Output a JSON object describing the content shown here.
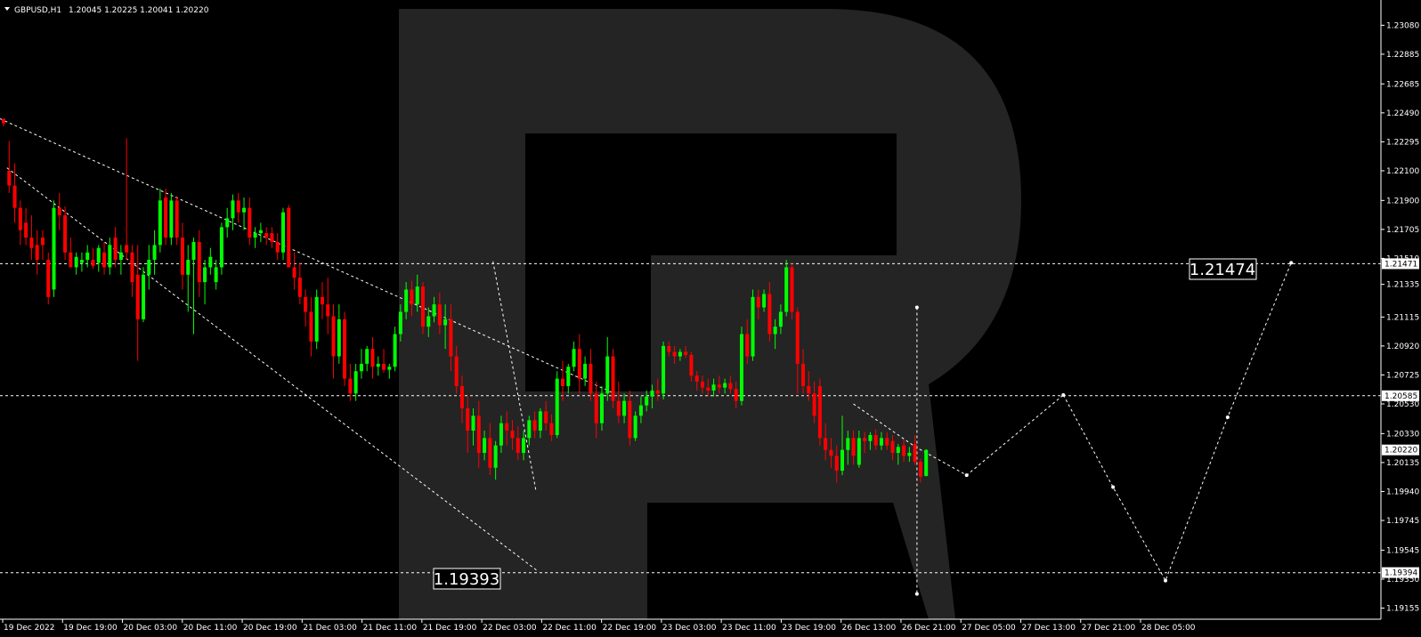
{
  "header": {
    "symbol": "GBPUSD,H1",
    "ohlc": "1.20045 1.20225 1.20041 1.20220"
  },
  "colors": {
    "background": "#000000",
    "bull": "#00ff00",
    "bear": "#ff0000",
    "grid_line": "#ffffff",
    "watermark": "#242424",
    "text": "#ffffff"
  },
  "annotations": {
    "target_high": "1.21474",
    "target_low": "1.19393"
  },
  "chart_data": {
    "type": "candlestick",
    "symbol": "GBPUSD",
    "timeframe": "H1",
    "ylim": [
      1.1908,
      1.2325
    ],
    "y_ticks": [
      "1.23080",
      "1.22885",
      "1.22685",
      "1.22490",
      "1.22295",
      "1.22100",
      "1.21900",
      "1.21705",
      "1.21510",
      "1.21335",
      "1.21115",
      "1.20920",
      "1.20725",
      "1.20530",
      "1.20330",
      "1.20135",
      "1.19940",
      "1.19745",
      "1.19545",
      "1.19350",
      "1.19155"
    ],
    "x_ticks": [
      "19 Dec 2022",
      "19 Dec 19:00",
      "20 Dec 03:00",
      "20 Dec 11:00",
      "20 Dec 19:00",
      "21 Dec 03:00",
      "21 Dec 11:00",
      "21 Dec 19:00",
      "22 Dec 03:00",
      "22 Dec 11:00",
      "22 Dec 19:00",
      "23 Dec 03:00",
      "23 Dec 11:00",
      "23 Dec 19:00",
      "26 Dec 13:00",
      "26 Dec 21:00",
      "27 Dec 05:00",
      "27 Dec 13:00",
      "27 Dec 21:00",
      "28 Dec 05:00"
    ],
    "price_markers": [
      {
        "value": 1.21474,
        "label": "1.21471"
      },
      {
        "value": 1.20585,
        "label": "1.20585"
      },
      {
        "value": 1.2022,
        "label": "1.20220"
      },
      {
        "value": 1.19394,
        "label": "1.19394"
      }
    ],
    "horizontal_levels": [
      1.21474,
      1.20585,
      1.19393
    ],
    "candles": [
      {
        "o": 1.2245,
        "h": 1.2245,
        "l": 1.224,
        "c": 1.2242
      },
      {
        "o": 1.221,
        "h": 1.223,
        "l": 1.2195,
        "c": 1.22
      },
      {
        "o": 1.22,
        "h": 1.2215,
        "l": 1.2175,
        "c": 1.2185
      },
      {
        "o": 1.2185,
        "h": 1.219,
        "l": 1.216,
        "c": 1.217
      },
      {
        "o": 1.2175,
        "h": 1.2185,
        "l": 1.216,
        "c": 1.2165
      },
      {
        "o": 1.2165,
        "h": 1.218,
        "l": 1.215,
        "c": 1.2158
      },
      {
        "o": 1.216,
        "h": 1.217,
        "l": 1.214,
        "c": 1.215
      },
      {
        "o": 1.2165,
        "h": 1.217,
        "l": 1.215,
        "c": 1.216
      },
      {
        "o": 1.215,
        "h": 1.2155,
        "l": 1.212,
        "c": 1.2125
      },
      {
        "o": 1.213,
        "h": 1.219,
        "l": 1.2125,
        "c": 1.2185
      },
      {
        "o": 1.2185,
        "h": 1.2195,
        "l": 1.217,
        "c": 1.218
      },
      {
        "o": 1.218,
        "h": 1.2186,
        "l": 1.215,
        "c": 1.2155
      },
      {
        "o": 1.2155,
        "h": 1.2165,
        "l": 1.2145,
        "c": 1.2145
      },
      {
        "o": 1.2145,
        "h": 1.2155,
        "l": 1.214,
        "c": 1.2152
      },
      {
        "o": 1.2148,
        "h": 1.2155,
        "l": 1.2142,
        "c": 1.215
      },
      {
        "o": 1.215,
        "h": 1.216,
        "l": 1.2145,
        "c": 1.2155
      },
      {
        "o": 1.215,
        "h": 1.2158,
        "l": 1.2144,
        "c": 1.2146
      },
      {
        "o": 1.2148,
        "h": 1.216,
        "l": 1.2142,
        "c": 1.2158
      },
      {
        "o": 1.2155,
        "h": 1.2162,
        "l": 1.214,
        "c": 1.2145
      },
      {
        "o": 1.2145,
        "h": 1.2165,
        "l": 1.214,
        "c": 1.216
      },
      {
        "o": 1.2165,
        "h": 1.2172,
        "l": 1.2145,
        "c": 1.215
      },
      {
        "o": 1.215,
        "h": 1.216,
        "l": 1.214,
        "c": 1.2155
      },
      {
        "o": 1.216,
        "h": 1.2232,
        "l": 1.215,
        "c": 1.2155
      },
      {
        "o": 1.2155,
        "h": 1.216,
        "l": 1.2125,
        "c": 1.2135
      },
      {
        "o": 1.214,
        "h": 1.216,
        "l": 1.2082,
        "c": 1.211
      },
      {
        "o": 1.211,
        "h": 1.2145,
        "l": 1.2108,
        "c": 1.214
      },
      {
        "o": 1.214,
        "h": 1.216,
        "l": 1.213,
        "c": 1.215
      },
      {
        "o": 1.215,
        "h": 1.217,
        "l": 1.214,
        "c": 1.216
      },
      {
        "o": 1.216,
        "h": 1.2198,
        "l": 1.2155,
        "c": 1.219
      },
      {
        "o": 1.2192,
        "h": 1.2198,
        "l": 1.216,
        "c": 1.2165
      },
      {
        "o": 1.2165,
        "h": 1.2195,
        "l": 1.216,
        "c": 1.219
      },
      {
        "o": 1.219,
        "h": 1.2193,
        "l": 1.216,
        "c": 1.2165
      },
      {
        "o": 1.2165,
        "h": 1.2175,
        "l": 1.213,
        "c": 1.214
      },
      {
        "o": 1.214,
        "h": 1.216,
        "l": 1.2115,
        "c": 1.215
      },
      {
        "o": 1.215,
        "h": 1.2165,
        "l": 1.21,
        "c": 1.2162
      },
      {
        "o": 1.2162,
        "h": 1.217,
        "l": 1.2125,
        "c": 1.2135
      },
      {
        "o": 1.2135,
        "h": 1.215,
        "l": 1.212,
        "c": 1.2145
      },
      {
        "o": 1.2145,
        "h": 1.2158,
        "l": 1.214,
        "c": 1.2152
      },
      {
        "o": 1.2135,
        "h": 1.215,
        "l": 1.213,
        "c": 1.2145
      },
      {
        "o": 1.2145,
        "h": 1.2175,
        "l": 1.214,
        "c": 1.2172
      },
      {
        "o": 1.2172,
        "h": 1.2185,
        "l": 1.2165,
        "c": 1.2178
      },
      {
        "o": 1.2178,
        "h": 1.2194,
        "l": 1.217,
        "c": 1.219
      },
      {
        "o": 1.219,
        "h": 1.2195,
        "l": 1.2175,
        "c": 1.2182
      },
      {
        "o": 1.2182,
        "h": 1.2192,
        "l": 1.217,
        "c": 1.2185
      },
      {
        "o": 1.2185,
        "h": 1.2192,
        "l": 1.216,
        "c": 1.2165
      },
      {
        "o": 1.2165,
        "h": 1.2172,
        "l": 1.2158,
        "c": 1.2168
      },
      {
        "o": 1.2168,
        "h": 1.2175,
        "l": 1.2162,
        "c": 1.217
      },
      {
        "o": 1.2168,
        "h": 1.2172,
        "l": 1.216,
        "c": 1.2165
      },
      {
        "o": 1.2168,
        "h": 1.2172,
        "l": 1.2158,
        "c": 1.2162
      },
      {
        "o": 1.2162,
        "h": 1.2168,
        "l": 1.215,
        "c": 1.2155
      },
      {
        "o": 1.2155,
        "h": 1.2185,
        "l": 1.215,
        "c": 1.2182
      },
      {
        "o": 1.2185,
        "h": 1.2187,
        "l": 1.215,
        "c": 1.2145
      },
      {
        "o": 1.2145,
        "h": 1.2155,
        "l": 1.213,
        "c": 1.2138
      },
      {
        "o": 1.2138,
        "h": 1.2148,
        "l": 1.212,
        "c": 1.2125
      },
      {
        "o": 1.2125,
        "h": 1.213,
        "l": 1.2105,
        "c": 1.2115
      },
      {
        "o": 1.2115,
        "h": 1.2125,
        "l": 1.2085,
        "c": 1.2095
      },
      {
        "o": 1.2095,
        "h": 1.213,
        "l": 1.209,
        "c": 1.2125
      },
      {
        "o": 1.2125,
        "h": 1.2135,
        "l": 1.211,
        "c": 1.212
      },
      {
        "o": 1.212,
        "h": 1.2138,
        "l": 1.21,
        "c": 1.2112
      },
      {
        "o": 1.2112,
        "h": 1.212,
        "l": 1.207,
        "c": 1.2085
      },
      {
        "o": 1.2085,
        "h": 1.212,
        "l": 1.208,
        "c": 1.211
      },
      {
        "o": 1.211,
        "h": 1.2115,
        "l": 1.2065,
        "c": 1.207
      },
      {
        "o": 1.207,
        "h": 1.208,
        "l": 1.2055,
        "c": 1.206
      },
      {
        "o": 1.206,
        "h": 1.208,
        "l": 1.2055,
        "c": 1.2075
      },
      {
        "o": 1.2075,
        "h": 1.209,
        "l": 1.207,
        "c": 1.208
      },
      {
        "o": 1.208,
        "h": 1.2092,
        "l": 1.2075,
        "c": 1.209
      },
      {
        "o": 1.209,
        "h": 1.2098,
        "l": 1.207,
        "c": 1.2078
      },
      {
        "o": 1.2078,
        "h": 1.2085,
        "l": 1.2072,
        "c": 1.208
      },
      {
        "o": 1.208,
        "h": 1.209,
        "l": 1.2074,
        "c": 1.2076
      },
      {
        "o": 1.2076,
        "h": 1.208,
        "l": 1.207,
        "c": 1.2078
      },
      {
        "o": 1.2078,
        "h": 1.2105,
        "l": 1.2075,
        "c": 1.21
      },
      {
        "o": 1.21,
        "h": 1.212,
        "l": 1.2095,
        "c": 1.2115
      },
      {
        "o": 1.2115,
        "h": 1.2135,
        "l": 1.211,
        "c": 1.213
      },
      {
        "o": 1.213,
        "h": 1.2136,
        "l": 1.2112,
        "c": 1.212
      },
      {
        "o": 1.212,
        "h": 1.214,
        "l": 1.2115,
        "c": 1.2132
      },
      {
        "o": 1.2132,
        "h": 1.2135,
        "l": 1.21,
        "c": 1.2105
      },
      {
        "o": 1.2105,
        "h": 1.2118,
        "l": 1.2098,
        "c": 1.2112
      },
      {
        "o": 1.2112,
        "h": 1.2125,
        "l": 1.2108,
        "c": 1.212
      },
      {
        "o": 1.212,
        "h": 1.2128,
        "l": 1.21,
        "c": 1.2106
      },
      {
        "o": 1.2106,
        "h": 1.212,
        "l": 1.209,
        "c": 1.211
      },
      {
        "o": 1.211,
        "h": 1.212,
        "l": 1.2075,
        "c": 1.2085
      },
      {
        "o": 1.2085,
        "h": 1.2092,
        "l": 1.206,
        "c": 1.2065
      },
      {
        "o": 1.2065,
        "h": 1.2072,
        "l": 1.204,
        "c": 1.205
      },
      {
        "o": 1.205,
        "h": 1.2058,
        "l": 1.202,
        "c": 1.2035
      },
      {
        "o": 1.2035,
        "h": 1.205,
        "l": 1.2025,
        "c": 1.2045
      },
      {
        "o": 1.2045,
        "h": 1.2055,
        "l": 1.201,
        "c": 1.202
      },
      {
        "o": 1.202,
        "h": 1.2035,
        "l": 1.2015,
        "c": 1.203
      },
      {
        "o": 1.203,
        "h": 1.204,
        "l": 1.2005,
        "c": 1.201
      },
      {
        "o": 1.201,
        "h": 1.2028,
        "l": 1.2002,
        "c": 1.2025
      },
      {
        "o": 1.2025,
        "h": 1.2045,
        "l": 1.202,
        "c": 1.204
      },
      {
        "o": 1.204,
        "h": 1.2048,
        "l": 1.2025,
        "c": 1.2035
      },
      {
        "o": 1.2035,
        "h": 1.2042,
        "l": 1.2022,
        "c": 1.203
      },
      {
        "o": 1.203,
        "h": 1.2038,
        "l": 1.2015,
        "c": 1.202
      },
      {
        "o": 1.202,
        "h": 1.2035,
        "l": 1.2015,
        "c": 1.203
      },
      {
        "o": 1.203,
        "h": 1.2045,
        "l": 1.2025,
        "c": 1.2042
      },
      {
        "o": 1.2042,
        "h": 1.2048,
        "l": 1.203,
        "c": 1.2035
      },
      {
        "o": 1.2035,
        "h": 1.205,
        "l": 1.203,
        "c": 1.2048
      },
      {
        "o": 1.2048,
        "h": 1.2055,
        "l": 1.2035,
        "c": 1.204
      },
      {
        "o": 1.204,
        "h": 1.2046,
        "l": 1.2028,
        "c": 1.2032
      },
      {
        "o": 1.2032,
        "h": 1.2075,
        "l": 1.203,
        "c": 1.207
      },
      {
        "o": 1.207,
        "h": 1.2082,
        "l": 1.2055,
        "c": 1.2065
      },
      {
        "o": 1.2065,
        "h": 1.208,
        "l": 1.206,
        "c": 1.2078
      },
      {
        "o": 1.2078,
        "h": 1.2095,
        "l": 1.2075,
        "c": 1.209
      },
      {
        "o": 1.209,
        "h": 1.21,
        "l": 1.206,
        "c": 1.207
      },
      {
        "o": 1.207,
        "h": 1.2085,
        "l": 1.2065,
        "c": 1.208
      },
      {
        "o": 1.208,
        "h": 1.209,
        "l": 1.2055,
        "c": 1.206
      },
      {
        "o": 1.206,
        "h": 1.2068,
        "l": 1.203,
        "c": 1.204
      },
      {
        "o": 1.204,
        "h": 1.2065,
        "l": 1.2035,
        "c": 1.206
      },
      {
        "o": 1.206,
        "h": 1.2098,
        "l": 1.2055,
        "c": 1.2085
      },
      {
        "o": 1.2085,
        "h": 1.209,
        "l": 1.205,
        "c": 1.2055
      },
      {
        "o": 1.2055,
        "h": 1.2068,
        "l": 1.204,
        "c": 1.2045
      },
      {
        "o": 1.2045,
        "h": 1.206,
        "l": 1.204,
        "c": 1.2055
      },
      {
        "o": 1.2055,
        "h": 1.2062,
        "l": 1.2025,
        "c": 1.203
      },
      {
        "o": 1.203,
        "h": 1.2048,
        "l": 1.2028,
        "c": 1.2045
      },
      {
        "o": 1.2045,
        "h": 1.2058,
        "l": 1.204,
        "c": 1.2052
      },
      {
        "o": 1.2052,
        "h": 1.2062,
        "l": 1.2048,
        "c": 1.2058
      },
      {
        "o": 1.2058,
        "h": 1.2066,
        "l": 1.205,
        "c": 1.2062
      },
      {
        "o": 1.2062,
        "h": 1.207,
        "l": 1.2055,
        "c": 1.206
      },
      {
        "o": 1.206,
        "h": 1.2095,
        "l": 1.2056,
        "c": 1.2092
      },
      {
        "o": 1.2092,
        "h": 1.2095,
        "l": 1.2085,
        "c": 1.2088
      },
      {
        "o": 1.2088,
        "h": 1.2092,
        "l": 1.208,
        "c": 1.2085
      },
      {
        "o": 1.2085,
        "h": 1.209,
        "l": 1.2082,
        "c": 1.2088
      },
      {
        "o": 1.2088,
        "h": 1.2092,
        "l": 1.2084,
        "c": 1.2086
      },
      {
        "o": 1.2086,
        "h": 1.2088,
        "l": 1.2068,
        "c": 1.2072
      },
      {
        "o": 1.2072,
        "h": 1.2075,
        "l": 1.2062,
        "c": 1.2068
      },
      {
        "o": 1.2068,
        "h": 1.2072,
        "l": 1.206,
        "c": 1.2064
      },
      {
        "o": 1.2064,
        "h": 1.207,
        "l": 1.2058,
        "c": 1.2062
      },
      {
        "o": 1.2062,
        "h": 1.207,
        "l": 1.2058,
        "c": 1.2066
      },
      {
        "o": 1.2066,
        "h": 1.2072,
        "l": 1.206,
        "c": 1.2064
      },
      {
        "o": 1.2064,
        "h": 1.207,
        "l": 1.206,
        "c": 1.2067
      },
      {
        "o": 1.2067,
        "h": 1.2072,
        "l": 1.206,
        "c": 1.2063
      },
      {
        "o": 1.2063,
        "h": 1.2068,
        "l": 1.205,
        "c": 1.2055
      },
      {
        "o": 1.2055,
        "h": 1.2105,
        "l": 1.2052,
        "c": 1.21
      },
      {
        "o": 1.21,
        "h": 1.211,
        "l": 1.208,
        "c": 1.2085
      },
      {
        "o": 1.2085,
        "h": 1.213,
        "l": 1.2082,
        "c": 1.2125
      },
      {
        "o": 1.2125,
        "h": 1.213,
        "l": 1.211,
        "c": 1.2118
      },
      {
        "o": 1.2118,
        "h": 1.213,
        "l": 1.2115,
        "c": 1.2127
      },
      {
        "o": 1.2127,
        "h": 1.2135,
        "l": 1.2095,
        "c": 1.21
      },
      {
        "o": 1.21,
        "h": 1.211,
        "l": 1.209,
        "c": 1.2105
      },
      {
        "o": 1.2105,
        "h": 1.212,
        "l": 1.21,
        "c": 1.2115
      },
      {
        "o": 1.2115,
        "h": 1.215,
        "l": 1.2112,
        "c": 1.2145
      },
      {
        "o": 1.2145,
        "h": 1.2148,
        "l": 1.211,
        "c": 1.2115
      },
      {
        "o": 1.2115,
        "h": 1.2118,
        "l": 1.206,
        "c": 1.208
      },
      {
        "o": 1.208,
        "h": 1.209,
        "l": 1.206,
        "c": 1.2065
      },
      {
        "o": 1.2065,
        "h": 1.2075,
        "l": 1.2055,
        "c": 1.206
      },
      {
        "o": 1.206,
        "h": 1.2068,
        "l": 1.204,
        "c": 1.2045
      },
      {
        "o": 1.2065,
        "h": 1.207,
        "l": 1.2025,
        "c": 1.203
      },
      {
        "o": 1.203,
        "h": 1.204,
        "l": 1.2015,
        "c": 1.2022
      },
      {
        "o": 1.2022,
        "h": 1.203,
        "l": 1.201,
        "c": 1.2018
      },
      {
        "o": 1.2018,
        "h": 1.2025,
        "l": 1.2,
        "c": 1.2008
      },
      {
        "o": 1.2008,
        "h": 1.2045,
        "l": 1.2005,
        "c": 1.2022
      },
      {
        "o": 1.2022,
        "h": 1.2035,
        "l": 1.2012,
        "c": 1.203
      },
      {
        "o": 1.203,
        "h": 1.2035,
        "l": 1.2012,
        "c": 1.2018
      },
      {
        "o": 1.2012,
        "h": 1.2035,
        "l": 1.201,
        "c": 1.203
      },
      {
        "o": 1.203,
        "h": 1.2034,
        "l": 1.202,
        "c": 1.2028
      },
      {
        "o": 1.2028,
        "h": 1.2034,
        "l": 1.2022,
        "c": 1.2032
      },
      {
        "o": 1.2032,
        "h": 1.2036,
        "l": 1.2022,
        "c": 1.2025
      },
      {
        "o": 1.2025,
        "h": 1.2034,
        "l": 1.2022,
        "c": 1.203
      },
      {
        "o": 1.203,
        "h": 1.2034,
        "l": 1.2022,
        "c": 1.2025
      },
      {
        "o": 1.2028,
        "h": 1.2032,
        "l": 1.2015,
        "c": 1.202
      },
      {
        "o": 1.202,
        "h": 1.2026,
        "l": 1.2012,
        "c": 1.2024
      },
      {
        "o": 1.2025,
        "h": 1.2029,
        "l": 1.2014,
        "c": 1.2018
      },
      {
        "o": 1.2018,
        "h": 1.2024,
        "l": 1.2014,
        "c": 1.202
      },
      {
        "o": 1.2026,
        "h": 1.2032,
        "l": 1.2012,
        "c": 1.2014
      },
      {
        "o": 1.2014,
        "h": 1.2016,
        "l": 1.2,
        "c": 1.2004
      },
      {
        "o": 1.20045,
        "h": 1.20225,
        "l": 1.20041,
        "c": 1.2022
      }
    ],
    "dashed_lines": [
      [
        [
          0,
          1.2245
        ],
        [
          0.445,
          1.206
        ]
      ],
      [
        [
          0.005,
          1.2212
        ],
        [
          0.39,
          1.194
        ]
      ],
      [
        [
          0.357,
          1.2149
        ],
        [
          0.388,
          1.1995
        ]
      ],
      [
        [
          0.618,
          1.2053
        ],
        [
          0.663,
          1.2024
        ],
        [
          0.7,
          1.2005
        ],
        [
          0.77,
          1.2059
        ]
      ],
      [
        [
          0.664,
          1.2118
        ],
        [
          0.664,
          1.1925
        ]
      ],
      [
        [
          0.77,
          1.2059
        ],
        [
          0.806,
          1.1997
        ],
        [
          0.844,
          1.1934
        ],
        [
          0.889,
          1.2044
        ],
        [
          0.935,
          1.2148
        ]
      ]
    ],
    "forecast_nodes": [
      [
        0.664,
        1.2118
      ],
      [
        0.664,
        1.1925
      ],
      [
        0.663,
        1.2024
      ],
      [
        0.7,
        1.2005
      ],
      [
        0.77,
        1.2059
      ],
      [
        0.806,
        1.1997
      ],
      [
        0.844,
        1.1934
      ],
      [
        0.889,
        1.2044
      ],
      [
        0.935,
        1.2148
      ]
    ]
  }
}
